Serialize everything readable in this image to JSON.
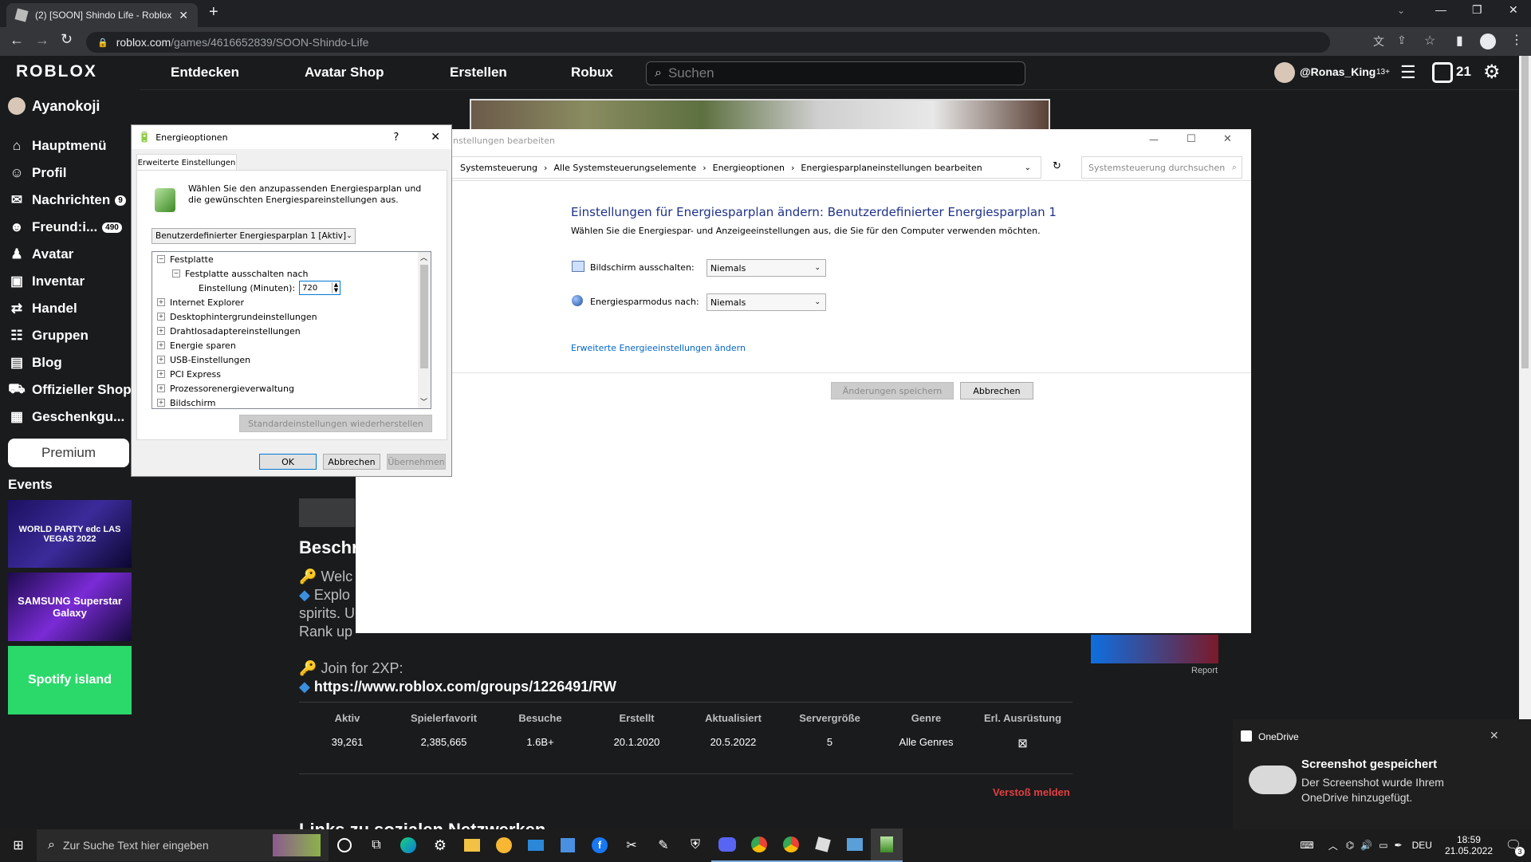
{
  "browser": {
    "tab_title": "(2) [SOON] Shindo Life - Roblox",
    "url_host": "roblox.com",
    "url_path": "/games/4616652839/SOON-Shindo-Life"
  },
  "roblox": {
    "logo": "ROBLOX",
    "nav": [
      "Entdecken",
      "Avatar Shop",
      "Erstellen",
      "Robux"
    ],
    "search_placeholder": "Suchen",
    "username": "@Ronas_King",
    "age_badge": "13+",
    "robux": "21",
    "sidebar": {
      "user": "Ayanokoji",
      "items": [
        {
          "label": "Hauptmenü",
          "icon": "home-icon",
          "badge": ""
        },
        {
          "label": "Profil",
          "icon": "profile-icon",
          "badge": ""
        },
        {
          "label": "Nachrichten",
          "icon": "messages-icon",
          "badge": "9"
        },
        {
          "label": "Freund:i...",
          "icon": "friends-icon",
          "badge": "490"
        },
        {
          "label": "Avatar",
          "icon": "avatar-icon",
          "badge": ""
        },
        {
          "label": "Inventar",
          "icon": "inventory-icon",
          "badge": ""
        },
        {
          "label": "Handel",
          "icon": "trade-icon",
          "badge": ""
        },
        {
          "label": "Gruppen",
          "icon": "groups-icon",
          "badge": ""
        },
        {
          "label": "Blog",
          "icon": "blog-icon",
          "badge": ""
        },
        {
          "label": "Offizieller Shop",
          "icon": "shop-icon",
          "badge": ""
        },
        {
          "label": "Geschenkgu...",
          "icon": "giftcard-icon",
          "badge": ""
        }
      ],
      "premium": "Premium",
      "events_title": "Events",
      "events": [
        "WORLD PARTY edc LAS VEGAS 2022",
        "SAMSUNG Superstar Galaxy",
        "Spotify island"
      ]
    },
    "description": {
      "title": "Beschr",
      "line1": "Welc",
      "line2": "Explo",
      "line3": "spirits. U",
      "line4": "Rank up",
      "join_label": "Join for 2XP:",
      "link": "https://www.roblox.com/groups/1226491/RW"
    },
    "report_label": "Report",
    "stats": {
      "headers": [
        "Aktiv",
        "Spielerfavorit",
        "Besuche",
        "Erstellt",
        "Aktualisiert",
        "Servergröße",
        "Genre",
        "Erl. Ausrüstung"
      ],
      "values": [
        "39,261",
        "2,385,665",
        "1.6B+",
        "20.1.2020",
        "20.5.2022",
        "5",
        "Alle Genres",
        ""
      ]
    },
    "report_abuse": "Verstoß melden",
    "social_title": "Links zu sozialen Netzwerken"
  },
  "cp_window": {
    "title": "nstellungen bearbeiten",
    "breadcrumb": [
      "Systemsteuerung",
      "Alle Systemsteuerungselemente",
      "Energieoptionen",
      "Energiesparplaneinstellungen bearbeiten"
    ],
    "search_placeholder": "Systemsteuerung durchsuchen",
    "heading": "Einstellungen für Energiesparplan ändern: Benutzerdefinierter Energiesparplan 1",
    "subheading": "Wählen Sie die Energiespar- und Anzeigeeinstellungen aus, die Sie für den Computer verwenden möchten.",
    "display_off_label": "Bildschirm ausschalten:",
    "display_off_value": "Niemals",
    "sleep_label": "Energiesparmodus nach:",
    "sleep_value": "Niemals",
    "advanced_link": "Erweiterte Energieeinstellungen ändern",
    "save_label": "Änderungen speichern",
    "cancel_label": "Abbrechen"
  },
  "power_dialog": {
    "title": "Energieoptionen",
    "help": "?",
    "tab": "Erweiterte Einstellungen",
    "intro": "Wählen Sie den anzupassenden Energiesparplan und die gewünschten Energiespareinstellungen aus.",
    "plan": "Benutzerdefinierter Energiesparplan 1 [Aktiv]",
    "tree": [
      {
        "sign": "−",
        "label": "Festplatte",
        "indent": 0
      },
      {
        "sign": "−",
        "label": "Festplatte ausschalten nach",
        "indent": 1
      },
      {
        "sign": "",
        "label": "Einstellung (Minuten):",
        "indent": 2,
        "value": "720"
      },
      {
        "sign": "+",
        "label": "Internet Explorer",
        "indent": 0
      },
      {
        "sign": "+",
        "label": "Desktophintergrundeinstellungen",
        "indent": 0
      },
      {
        "sign": "+",
        "label": "Drahtlosadaptereinstellungen",
        "indent": 0
      },
      {
        "sign": "+",
        "label": "Energie sparen",
        "indent": 0
      },
      {
        "sign": "+",
        "label": "USB-Einstellungen",
        "indent": 0
      },
      {
        "sign": "+",
        "label": "PCI Express",
        "indent": 0
      },
      {
        "sign": "+",
        "label": "Prozessorenergieverwaltung",
        "indent": 0
      },
      {
        "sign": "+",
        "label": "Bildschirm",
        "indent": 0
      }
    ],
    "restore": "Standardeinstellungen wiederherstellen",
    "ok": "OK",
    "cancel": "Abbrechen",
    "apply": "Übernehmen"
  },
  "notification": {
    "app": "OneDrive",
    "title": "Screenshot gespeichert",
    "body": "Der Screenshot wurde Ihrem OneDrive hinzugefügt."
  },
  "taskbar": {
    "search_placeholder": "Zur Suche Text hier eingeben",
    "lang": "DEU",
    "time": "18:59",
    "date": "21.05.2022",
    "notif_count": "3"
  }
}
